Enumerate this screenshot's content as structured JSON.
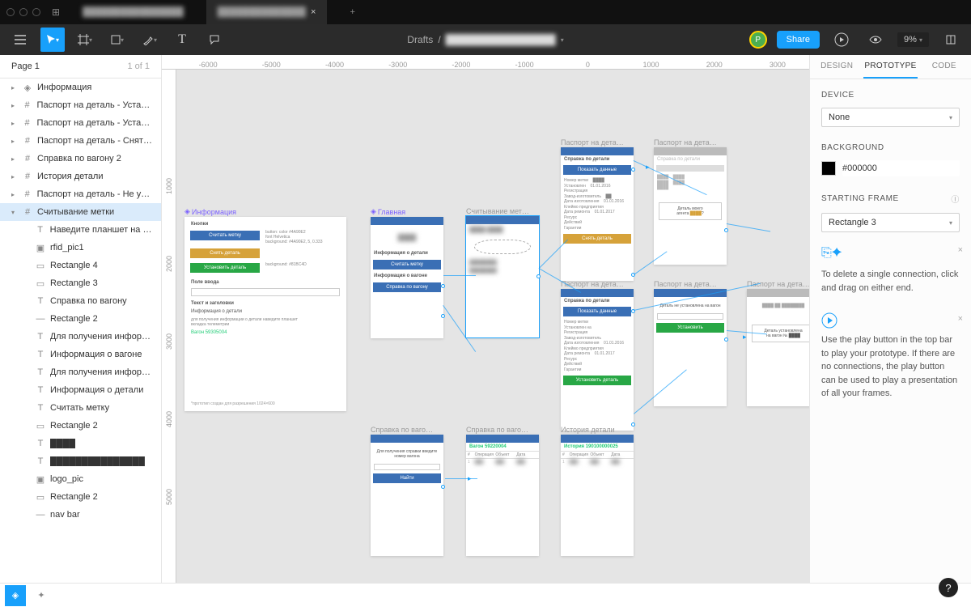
{
  "tabbar": {
    "tab1": "████████████████",
    "tab2": "██████████████",
    "close": "×",
    "plus": "+"
  },
  "toolbar": {
    "breadcrumb_root": "Drafts",
    "breadcrumb_sep": "/",
    "breadcrumb_file": "████████████████",
    "share": "Share",
    "zoom": "9%",
    "avatar": "P"
  },
  "left": {
    "page": "Page 1",
    "page_count": "1 of 1",
    "layers": [
      {
        "name": "Информация",
        "icon": "component",
        "chev": "▸"
      },
      {
        "name": "Паспорт на деталь - Устано…",
        "icon": "frame",
        "chev": "▸"
      },
      {
        "name": "Паспорт на деталь - Устано…",
        "icon": "frame",
        "chev": "▸"
      },
      {
        "name": "Паспорт на деталь - Снятие",
        "icon": "frame",
        "chev": "▸"
      },
      {
        "name": "Справка по вагону 2",
        "icon": "frame",
        "chev": "▸"
      },
      {
        "name": "История детали",
        "icon": "frame",
        "chev": "▸"
      },
      {
        "name": "Паспорт на деталь - Не уст…",
        "icon": "frame",
        "chev": "▸"
      },
      {
        "name": "Считывание метки",
        "icon": "frame",
        "chev": "▾",
        "sel": true
      },
      {
        "name": "Наведите планшет на м…",
        "icon": "text",
        "indent": 1
      },
      {
        "name": "rfid_pic1",
        "icon": "image",
        "indent": 1
      },
      {
        "name": "Rectangle 4",
        "icon": "rect",
        "indent": 1
      },
      {
        "name": "Rectangle 3",
        "icon": "rect",
        "indent": 1
      },
      {
        "name": "Справка по вагону",
        "icon": "text",
        "indent": 1
      },
      {
        "name": "Rectangle 2",
        "icon": "line",
        "indent": 1
      },
      {
        "name": "Для получения информ…",
        "icon": "text",
        "indent": 1
      },
      {
        "name": "Информация о вагоне",
        "icon": "text",
        "indent": 1
      },
      {
        "name": "Для получения информ…",
        "icon": "text",
        "indent": 1
      },
      {
        "name": "Информация о детали",
        "icon": "text",
        "indent": 1
      },
      {
        "name": "Считать метку",
        "icon": "text",
        "indent": 1
      },
      {
        "name": "Rectangle 2",
        "icon": "rect",
        "indent": 1
      },
      {
        "name": "████",
        "icon": "text",
        "indent": 1
      },
      {
        "name": "███████████████",
        "icon": "text",
        "indent": 1
      },
      {
        "name": "logo_pic",
        "icon": "image",
        "indent": 1
      },
      {
        "name": "Rectangle 2",
        "icon": "rect",
        "indent": 1
      },
      {
        "name": "nav bar",
        "icon": "line",
        "indent": 1
      }
    ]
  },
  "rulers": {
    "h": [
      "-6000",
      "-5000",
      "-4000",
      "-3000",
      "-2000",
      "-1000",
      "0",
      "1000",
      "2000",
      "3000"
    ],
    "v": [
      "",
      "1000",
      "2000",
      "3000",
      "4000",
      "5000"
    ]
  },
  "frames": {
    "info": {
      "label": "Информация",
      "h1": "Кнопки",
      "btn_blue": "Считать метку",
      "btn_yellow": "Снять деталь",
      "btn_green": "Установить деталь",
      "h2": "Поле ввода",
      "h3": "Текст и заголовки",
      "h4": "Информация о детали",
      "h5": "Вагон 59305004"
    },
    "main": {
      "label": "Главная",
      "a": "Информация о детали",
      "b": "Считать метку",
      "c": "Информация о вагоне",
      "d": "Справка по вагону"
    },
    "scan": {
      "label": "Считывание мет…"
    },
    "pass1": {
      "label": "Паспорт на дета…",
      "sub": "Справка по детали",
      "rb": "Показать данные",
      "ry": "Снять деталь"
    },
    "pass2": {
      "label": "Паспорт на дета…"
    },
    "pass3": {
      "label": "Паспорт на дета…",
      "sub": "Справка по детали",
      "rb": "Показать данные",
      "rg": "Установить деталь"
    },
    "pass4": {
      "label": "Паспорт на дета…",
      "t1": "Деталь не установлена на вагон",
      "rg": "Установить"
    },
    "pass5": {
      "label": "Паспорт на дета…",
      "t1": "Деталь установлена",
      "t2": "на вагон № ████"
    },
    "ref1": {
      "label": "Справка по ваго…",
      "t1": "Для получения справки введите номер вагона",
      "btn": "Найти"
    },
    "ref2": {
      "label": "Справка по ваго…",
      "t1": "Вагон 59220004",
      "c1": "#",
      "c2": "Операция",
      "c3": "Объект",
      "c4": "Дата"
    },
    "hist": {
      "label": "История детали",
      "t1": "История 190100000025",
      "c1": "#",
      "c2": "Операция",
      "c3": "Объект",
      "c4": "Дата"
    }
  },
  "right": {
    "tab1": "DESIGN",
    "tab2": "PROTOTYPE",
    "tab3": "CODE",
    "device_t": "DEVICE",
    "device_v": "None",
    "bg_t": "BACKGROUND",
    "bg_v": "#000000",
    "sf_t": "STARTING FRAME",
    "sf_v": "Rectangle 3",
    "hint1": "To delete a single connection, click and drag on either end.",
    "hint2": "Use the play button in the top bar to play your prototype. If there are no connections, the play button can be used to play a presentation of all your frames."
  }
}
